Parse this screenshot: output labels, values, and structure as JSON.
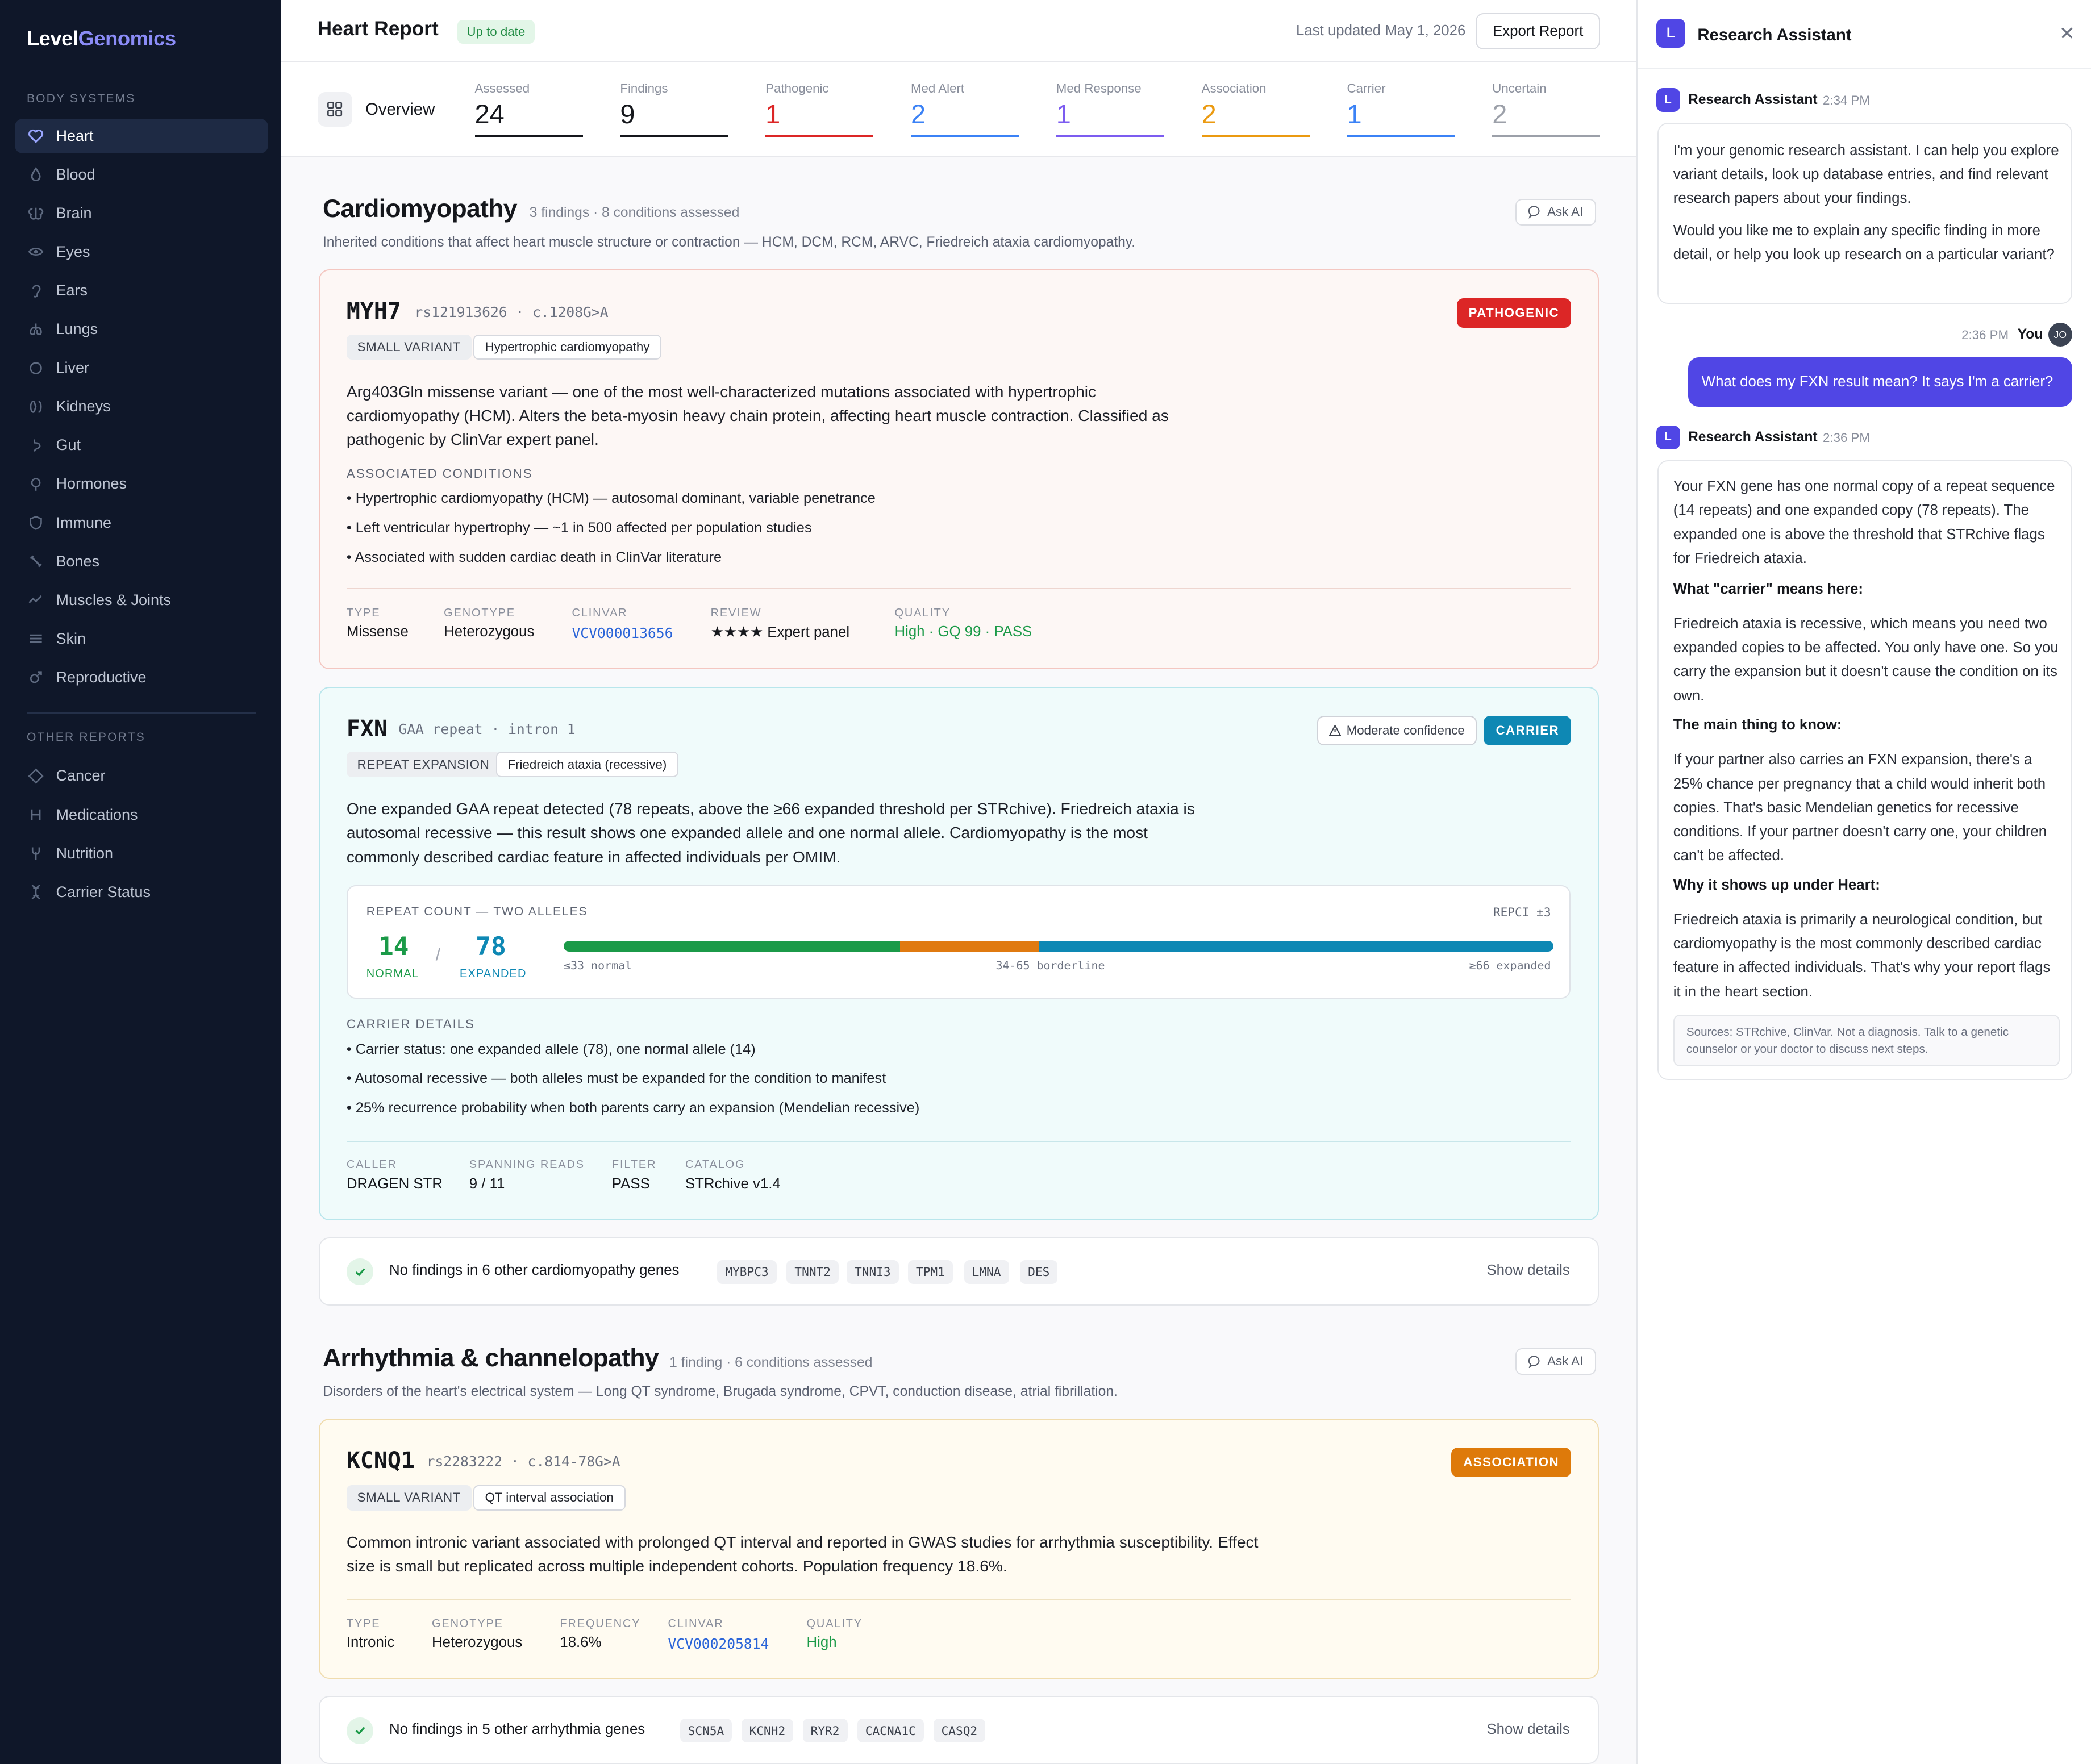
{
  "brand": {
    "part1": "Level",
    "part2": "Genomics"
  },
  "sidebar": {
    "section_body": "BODY SYSTEMS",
    "body_items": [
      "Heart",
      "Blood",
      "Brain",
      "Eyes",
      "Ears",
      "Lungs",
      "Liver",
      "Kidneys",
      "Gut",
      "Hormones",
      "Immune",
      "Bones",
      "Muscles & Joints",
      "Skin",
      "Reproductive"
    ],
    "section_other": "OTHER REPORTS",
    "other_items": [
      "Cancer",
      "Medications",
      "Nutrition",
      "Carrier Status"
    ]
  },
  "header": {
    "title": "Heart Report",
    "status_badge": "Up to date",
    "last_updated": "Last updated May 1, 2026",
    "export_label": "Export Report"
  },
  "stats": {
    "overview_label": "Overview",
    "items": [
      {
        "label": "Assessed",
        "value": "24",
        "color": "#15171c"
      },
      {
        "label": "Findings",
        "value": "9",
        "color": "#15171c"
      },
      {
        "label": "Pathogenic",
        "value": "1",
        "color": "#dc2626"
      },
      {
        "label": "Med Alert",
        "value": "2",
        "color": "#3b82f6"
      },
      {
        "label": "Med Response",
        "value": "1",
        "color": "#7c5cf0"
      },
      {
        "label": "Association",
        "value": "2",
        "color": "#eb9a10"
      },
      {
        "label": "Carrier",
        "value": "1",
        "color": "#3b82f6"
      },
      {
        "label": "Uncertain",
        "value": "2",
        "color": "#9ca0a9"
      }
    ]
  },
  "cardio": {
    "title": "Cardiomyopathy",
    "meta": "3 findings · 8 conditions assessed",
    "ask": "Ask AI",
    "desc": "Inherited conditions that affect heart muscle structure or contraction — HCM, DCM, RCM, ARVC, Friedreich ataxia cardiomyopathy."
  },
  "myh7": {
    "gene": "MYH7",
    "variant": "rs121913626 · c.1208G>A",
    "status": "PATHOGENIC",
    "tag1": "SMALL VARIANT",
    "tag2": "Hypertrophic cardiomyopathy",
    "desc": "Arg403Gln missense variant — one of the most well-characterized mutations associated with hypertrophic cardiomyopathy (HCM). Alters the beta-myosin heavy chain protein, affecting heart muscle contraction. Classified as pathogenic by ClinVar expert panel.",
    "cond_header": "ASSOCIATED CONDITIONS",
    "conditions": [
      "• Hypertrophic cardiomyopathy (HCM) — autosomal dominant, variable penetrance",
      "• Left ventricular hypertrophy — ~1 in 500 affected per population studies",
      "• Associated with sudden cardiac death in ClinVar literature"
    ],
    "meta": [
      {
        "k": "TYPE",
        "v": "Missense"
      },
      {
        "k": "GENOTYPE",
        "v": "Heterozygous"
      },
      {
        "k": "CLINVAR",
        "v": "VCV000013656"
      },
      {
        "k": "REVIEW",
        "v": "★★★★ Expert panel"
      },
      {
        "k": "QUALITY",
        "v": "High · GQ 99 · PASS"
      }
    ]
  },
  "fxn": {
    "gene": "FXN",
    "variant": "GAA repeat · intron 1",
    "confidence": "Moderate confidence",
    "status": "CARRIER",
    "tag1": "REPEAT EXPANSION",
    "tag2": "Friedreich ataxia (recessive)",
    "desc": "One expanded GAA repeat detected (78 repeats, above the ≥66 expanded threshold per STRchive). Friedreich ataxia is autosomal recessive — this result shows one expanded allele and one normal allele. Cardiomyopathy is the most commonly described cardiac feature in affected individuals per OMIM.",
    "repeat_header": "REPEAT COUNT — TWO ALLELES",
    "repci": "REPCI ±3",
    "allele1": "14",
    "allele1_label": "NORMAL",
    "slash": "/",
    "allele2": "78",
    "allele2_label": "EXPANDED",
    "range_normal": "≤33 normal",
    "range_border": "34-65 borderline",
    "range_expanded": "≥66 expanded",
    "carrier_header": "CARRIER DETAILS",
    "details": [
      "• Carrier status: one expanded allele (78), one normal allele (14)",
      "• Autosomal recessive — both alleles must be expanded for the condition to manifest",
      "• 25% recurrence probability when both parents carry an expansion (Mendelian recessive)"
    ],
    "meta": [
      {
        "k": "CALLER",
        "v": "DRAGEN STR"
      },
      {
        "k": "SPANNING READS",
        "v": "9 / 11"
      },
      {
        "k": "FILTER",
        "v": "PASS"
      },
      {
        "k": "CATALOG",
        "v": "STRchive v1.4"
      }
    ]
  },
  "nofind1": {
    "text": "No findings in 6 other cardiomyopathy genes",
    "genes": [
      "MYBPC3",
      "TNNT2",
      "TNNI3",
      "TPM1",
      "LMNA",
      "DES"
    ],
    "show": "Show details"
  },
  "arrhythmia": {
    "title": "Arrhythmia & channelopathy",
    "meta": "1 finding · 6 conditions assessed",
    "ask": "Ask AI",
    "desc": "Disorders of the heart's electrical system — Long QT syndrome, Brugada syndrome, CPVT, conduction disease, atrial fibrillation."
  },
  "kcnq1": {
    "gene": "KCNQ1",
    "variant": "rs2283222 · c.814-78G>A",
    "status": "ASSOCIATION",
    "tag1": "SMALL VARIANT",
    "tag2": "QT interval association",
    "desc": "Common intronic variant associated with prolonged QT interval and reported in GWAS studies for arrhythmia susceptibility. Effect size is small but replicated across multiple independent cohorts. Population frequency 18.6%.",
    "meta": [
      {
        "k": "TYPE",
        "v": "Intronic"
      },
      {
        "k": "GENOTYPE",
        "v": "Heterozygous"
      },
      {
        "k": "FREQUENCY",
        "v": "18.6%"
      },
      {
        "k": "CLINVAR",
        "v": "VCV000205814"
      },
      {
        "k": "QUALITY",
        "v": "High"
      }
    ]
  },
  "nofind2": {
    "text": "No findings in 5 other arrhythmia genes",
    "genes": [
      "SCN5A",
      "KCNH2",
      "RYR2",
      "CACNA1C",
      "CASQ2"
    ],
    "show": "Show details"
  },
  "assistant": {
    "title": "Research Assistant",
    "avatar": "L",
    "close": "✕",
    "msg1_name": "Research Assistant",
    "msg1_time": "2:34 PM",
    "msg1_p1": "I'm your genomic research assistant. I can help you explore variant details, look up database entries, and find relevant research papers about your findings.",
    "msg1_p2": "Would you like me to explain any specific finding in more detail, or help you look up research on a particular variant?",
    "user_time": "2:36 PM",
    "user_name": "You",
    "user_initials": "JO",
    "user_msg": "What does my FXN result mean? It says I'm a carrier?",
    "msg2_name": "Research Assistant",
    "msg2_time": "2:36 PM",
    "msg2_p1": "Your FXN gene has one normal copy of a repeat sequence (14 repeats) and one expanded copy (78 repeats). The expanded one is above the threshold that STRchive flags for Friedreich ataxia.",
    "msg2_h1": "What \"carrier\" means here:",
    "msg2_p2": "Friedreich ataxia is recessive, which means you need two expanded copies to be affected. You only have one. So you carry the expansion but it doesn't cause the condition on its own.",
    "msg2_h2": "The main thing to know:",
    "msg2_p3": "If your partner also carries an FXN expansion, there's a 25% chance per pregnancy that a child would inherit both copies. That's basic Mendelian genetics for recessive conditions. If your partner doesn't carry one, your children can't be affected.",
    "msg2_h3": "Why it shows up under Heart:",
    "msg2_p4": "Friedreich ataxia is primarily a neurological condition, but cardiomyopathy is the most commonly described cardiac feature in affected individuals. That's why your report flags it in the heart section.",
    "sources": "Sources: STRchive, ClinVar. Not a diagnosis. Talk to a genetic counselor or your doctor to discuss next steps."
  }
}
